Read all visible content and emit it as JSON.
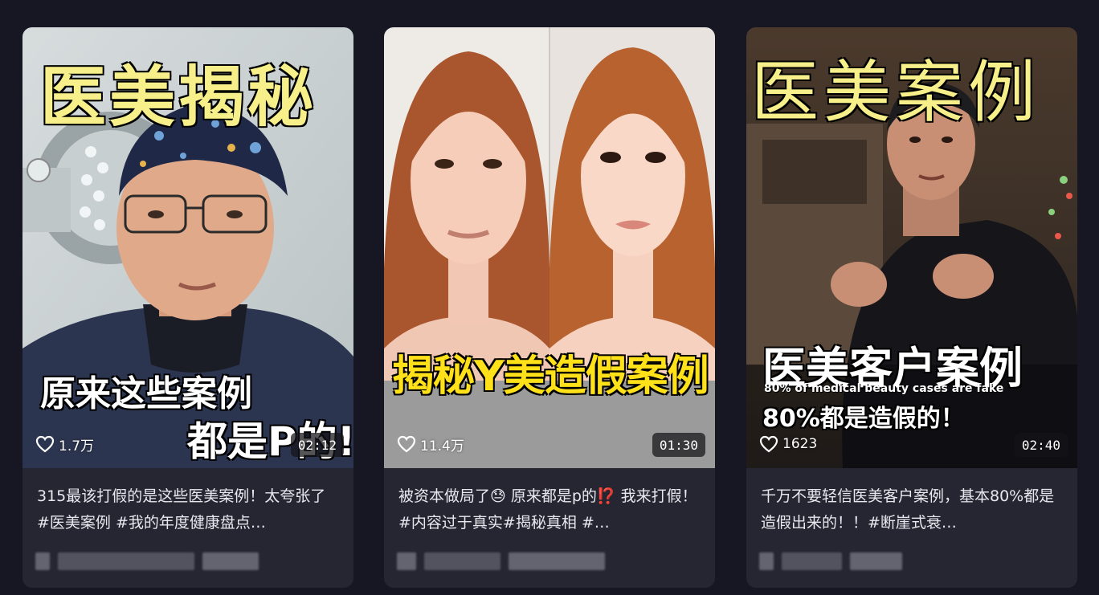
{
  "cards": [
    {
      "title_overlay": "医美揭秘",
      "sub_overlay_1": "原来这些案例",
      "sub_overlay_2": "都是P的!",
      "likes": "1.7万",
      "duration": "02:12",
      "description": "315最该打假的是这些医美案例！太夸张了 #医美案例 #我的年度健康盘点…"
    },
    {
      "title_overlay": "揭秘Y美造假案例",
      "likes": "11.4万",
      "duration": "01:30",
      "description": "被资本做局了😓 原来都是p的⁉️ 我来打假！ #内容过于真实#揭秘真相 #…"
    },
    {
      "title_overlay": "医美案例",
      "sub_overlay_1": "医美客户案例",
      "sub_overlay_en": "80% of medical beauty cases are fake",
      "sub_overlay_2": "80%都是造假的！",
      "likes": "1623",
      "duration": "02:40",
      "description": "千万不要轻信医美客户案例，基本80%都是造假出来的！！#断崖式衰…"
    }
  ],
  "colors": {
    "page_bg": "#161722",
    "card_bg": "#252632",
    "overlay_yellow": "#f7f08a",
    "overlay_bright_yellow": "#ffe11a"
  }
}
